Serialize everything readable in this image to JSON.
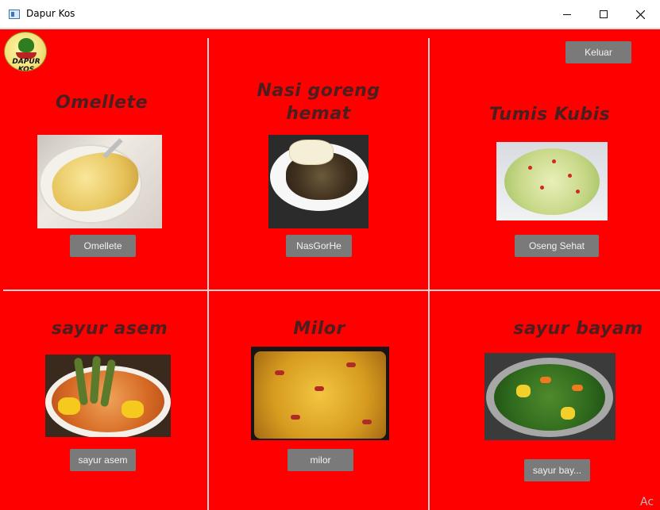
{
  "window": {
    "title": "Dapur Kos"
  },
  "logo": {
    "text": "DAPUR KOS"
  },
  "header": {
    "exit_label": "Keluar"
  },
  "menu": [
    {
      "heading": "Omellete",
      "button": "Omellete",
      "icon": "omelette-photo"
    },
    {
      "heading": "Nasi goreng hemat",
      "button": "NasGorHe",
      "icon": "fried-rice-photo"
    },
    {
      "heading": "Tumis Kubis",
      "button": "Oseng Sehat",
      "icon": "stir-fry-cabbage-photo"
    },
    {
      "heading": "sayur asem",
      "button": "sayur asem",
      "icon": "tamarind-soup-photo"
    },
    {
      "heading": "Milor",
      "button": "milor",
      "icon": "milor-photo"
    },
    {
      "heading": "sayur bayam",
      "button": "sayur bay...",
      "icon": "spinach-soup-photo"
    }
  ],
  "colors": {
    "background": "#ff0000",
    "heading": "#4a1f1f",
    "button": "#7a7a7a"
  },
  "watermark": "Ac"
}
